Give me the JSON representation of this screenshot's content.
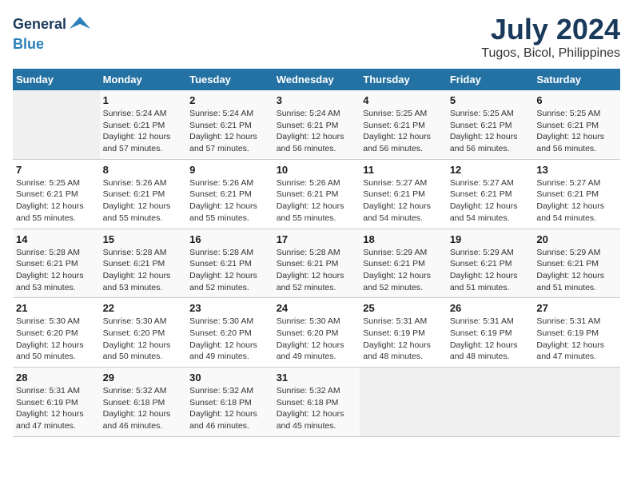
{
  "logo": {
    "line1": "General",
    "line2": "Blue"
  },
  "title": "July 2024",
  "subtitle": "Tugos, Bicol, Philippines",
  "days_header": [
    "Sunday",
    "Monday",
    "Tuesday",
    "Wednesday",
    "Thursday",
    "Friday",
    "Saturday"
  ],
  "weeks": [
    [
      {
        "num": "",
        "info": ""
      },
      {
        "num": "1",
        "info": "Sunrise: 5:24 AM\nSunset: 6:21 PM\nDaylight: 12 hours\nand 57 minutes."
      },
      {
        "num": "2",
        "info": "Sunrise: 5:24 AM\nSunset: 6:21 PM\nDaylight: 12 hours\nand 57 minutes."
      },
      {
        "num": "3",
        "info": "Sunrise: 5:24 AM\nSunset: 6:21 PM\nDaylight: 12 hours\nand 56 minutes."
      },
      {
        "num": "4",
        "info": "Sunrise: 5:25 AM\nSunset: 6:21 PM\nDaylight: 12 hours\nand 56 minutes."
      },
      {
        "num": "5",
        "info": "Sunrise: 5:25 AM\nSunset: 6:21 PM\nDaylight: 12 hours\nand 56 minutes."
      },
      {
        "num": "6",
        "info": "Sunrise: 5:25 AM\nSunset: 6:21 PM\nDaylight: 12 hours\nand 56 minutes."
      }
    ],
    [
      {
        "num": "7",
        "info": "Sunrise: 5:25 AM\nSunset: 6:21 PM\nDaylight: 12 hours\nand 55 minutes."
      },
      {
        "num": "8",
        "info": "Sunrise: 5:26 AM\nSunset: 6:21 PM\nDaylight: 12 hours\nand 55 minutes."
      },
      {
        "num": "9",
        "info": "Sunrise: 5:26 AM\nSunset: 6:21 PM\nDaylight: 12 hours\nand 55 minutes."
      },
      {
        "num": "10",
        "info": "Sunrise: 5:26 AM\nSunset: 6:21 PM\nDaylight: 12 hours\nand 55 minutes."
      },
      {
        "num": "11",
        "info": "Sunrise: 5:27 AM\nSunset: 6:21 PM\nDaylight: 12 hours\nand 54 minutes."
      },
      {
        "num": "12",
        "info": "Sunrise: 5:27 AM\nSunset: 6:21 PM\nDaylight: 12 hours\nand 54 minutes."
      },
      {
        "num": "13",
        "info": "Sunrise: 5:27 AM\nSunset: 6:21 PM\nDaylight: 12 hours\nand 54 minutes."
      }
    ],
    [
      {
        "num": "14",
        "info": "Sunrise: 5:28 AM\nSunset: 6:21 PM\nDaylight: 12 hours\nand 53 minutes."
      },
      {
        "num": "15",
        "info": "Sunrise: 5:28 AM\nSunset: 6:21 PM\nDaylight: 12 hours\nand 53 minutes."
      },
      {
        "num": "16",
        "info": "Sunrise: 5:28 AM\nSunset: 6:21 PM\nDaylight: 12 hours\nand 52 minutes."
      },
      {
        "num": "17",
        "info": "Sunrise: 5:28 AM\nSunset: 6:21 PM\nDaylight: 12 hours\nand 52 minutes."
      },
      {
        "num": "18",
        "info": "Sunrise: 5:29 AM\nSunset: 6:21 PM\nDaylight: 12 hours\nand 52 minutes."
      },
      {
        "num": "19",
        "info": "Sunrise: 5:29 AM\nSunset: 6:21 PM\nDaylight: 12 hours\nand 51 minutes."
      },
      {
        "num": "20",
        "info": "Sunrise: 5:29 AM\nSunset: 6:21 PM\nDaylight: 12 hours\nand 51 minutes."
      }
    ],
    [
      {
        "num": "21",
        "info": "Sunrise: 5:30 AM\nSunset: 6:20 PM\nDaylight: 12 hours\nand 50 minutes."
      },
      {
        "num": "22",
        "info": "Sunrise: 5:30 AM\nSunset: 6:20 PM\nDaylight: 12 hours\nand 50 minutes."
      },
      {
        "num": "23",
        "info": "Sunrise: 5:30 AM\nSunset: 6:20 PM\nDaylight: 12 hours\nand 49 minutes."
      },
      {
        "num": "24",
        "info": "Sunrise: 5:30 AM\nSunset: 6:20 PM\nDaylight: 12 hours\nand 49 minutes."
      },
      {
        "num": "25",
        "info": "Sunrise: 5:31 AM\nSunset: 6:19 PM\nDaylight: 12 hours\nand 48 minutes."
      },
      {
        "num": "26",
        "info": "Sunrise: 5:31 AM\nSunset: 6:19 PM\nDaylight: 12 hours\nand 48 minutes."
      },
      {
        "num": "27",
        "info": "Sunrise: 5:31 AM\nSunset: 6:19 PM\nDaylight: 12 hours\nand 47 minutes."
      }
    ],
    [
      {
        "num": "28",
        "info": "Sunrise: 5:31 AM\nSunset: 6:19 PM\nDaylight: 12 hours\nand 47 minutes."
      },
      {
        "num": "29",
        "info": "Sunrise: 5:32 AM\nSunset: 6:18 PM\nDaylight: 12 hours\nand 46 minutes."
      },
      {
        "num": "30",
        "info": "Sunrise: 5:32 AM\nSunset: 6:18 PM\nDaylight: 12 hours\nand 46 minutes."
      },
      {
        "num": "31",
        "info": "Sunrise: 5:32 AM\nSunset: 6:18 PM\nDaylight: 12 hours\nand 45 minutes."
      },
      {
        "num": "",
        "info": ""
      },
      {
        "num": "",
        "info": ""
      },
      {
        "num": "",
        "info": ""
      }
    ]
  ]
}
